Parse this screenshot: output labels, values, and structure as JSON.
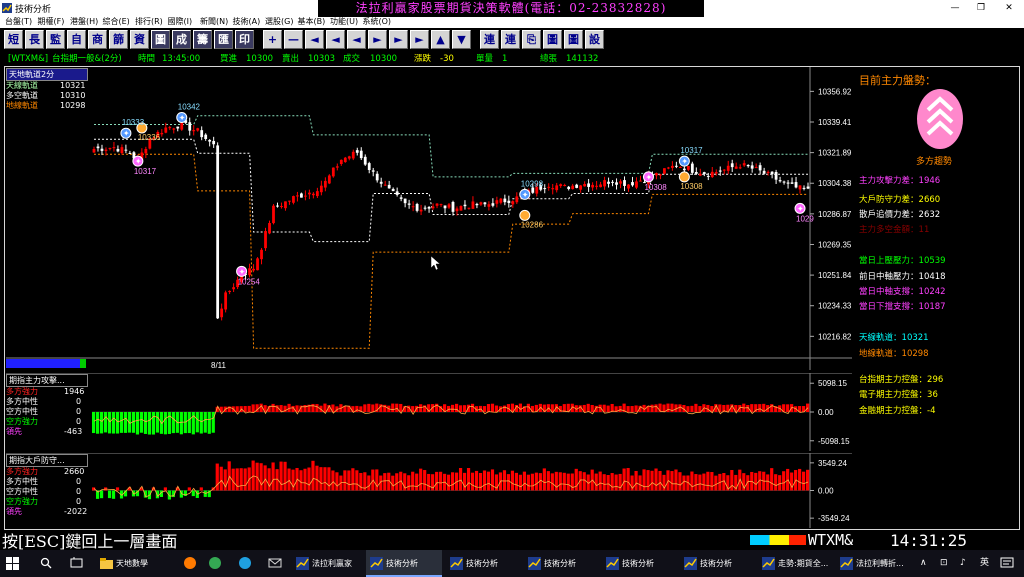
{
  "window": {
    "title": "技術分析",
    "min_glyph": "—",
    "max_glyph": "❐",
    "close_glyph": "✕"
  },
  "banner": "法拉利贏家股票期貨決策軟體(電話：02-23832828)",
  "menu": [
    "台盤(T)",
    "期權(F)",
    "港盤(H)",
    "綜合(E)",
    "排行(R)",
    "國際(I)",
    "新聞(N)",
    "技術(A)",
    "選股(G)",
    "基本(B)",
    "功能(U)",
    "系統(O)"
  ],
  "toolbar": [
    "短",
    "長",
    "監",
    "自",
    "商",
    "篩",
    "資",
    "圖",
    "成",
    "籌",
    "匯",
    "印",
    "+",
    "—",
    "◄",
    "◄",
    "◄",
    "►",
    "►",
    "►",
    "▲",
    "▼",
    "連",
    "連",
    "⎘",
    "圖",
    "圖",
    "設"
  ],
  "status": {
    "code": "[WTXM&]",
    "name": "台指期一般&(2分)",
    "time_label": "時間",
    "time": "13:45:00",
    "bid_label": "買進",
    "bid": "10300",
    "ask_label": "賣出",
    "ask": "10303",
    "deal_label": "成交",
    "deal": "10300",
    "chg_label": "漲跌",
    "chg": "-30",
    "vol_label": "單量",
    "vol": "1",
    "total_label": "總張",
    "total": "141132"
  },
  "main_legend": {
    "title": "天地軌道2分",
    "rows": [
      {
        "label": "天線軌道",
        "value": "10321"
      },
      {
        "label": "多空軌道",
        "value": "10310"
      },
      {
        "label": "地線軌道",
        "value": "10298"
      }
    ]
  },
  "sub1_legend": {
    "title": "期指主力攻擊...",
    "rows": [
      {
        "label": "多方強力",
        "value": "1946"
      },
      {
        "label": "多方中性",
        "value": "0"
      },
      {
        "label": "空方中性",
        "value": "0"
      },
      {
        "label": "空方強力",
        "value": "0"
      },
      {
        "label": "領先",
        "value": "-463"
      }
    ]
  },
  "sub2_legend": {
    "title": "期指大戶防守...",
    "rows": [
      {
        "label": "多方強力",
        "value": "2660"
      },
      {
        "label": "多方中性",
        "value": "0"
      },
      {
        "label": "空方中性",
        "value": "0"
      },
      {
        "label": "空方強力",
        "value": "0"
      },
      {
        "label": "領先",
        "value": "-2022"
      }
    ]
  },
  "colors": {
    "up": "#ff0000",
    "down": "#ffffff",
    "sky": "#88ddbb",
    "ground": "#ff8800",
    "mid": "#ffffff",
    "bull_fill": "#ff0000",
    "bear_fill": "#00ff00"
  },
  "chart_data": [
    {
      "type": "candlestick",
      "y_ticks": [
        "10356.92",
        "10339.41",
        "10321.89",
        "10304.38",
        "10286.87",
        "10269.35",
        "10251.84",
        "10234.33",
        "10216.82"
      ],
      "ylim": [
        10205,
        10368
      ],
      "x_tick": "8/11",
      "markers": [
        {
          "label": "10342",
          "kind": "sky",
          "price": 10342,
          "idx": 22
        },
        {
          "label": "10336",
          "kind": "ground",
          "price": 10336,
          "idx": 12
        },
        {
          "label": "10333",
          "kind": "sky",
          "price": 10333,
          "idx": 8
        },
        {
          "label": "10317",
          "kind": "low",
          "price": 10317,
          "idx": 11
        },
        {
          "label": "10254",
          "kind": "low",
          "price": 10254,
          "idx": 37
        },
        {
          "label": "10298",
          "kind": "sky",
          "price": 10298,
          "idx": 108
        },
        {
          "label": "10286",
          "kind": "ground",
          "price": 10286,
          "idx": 108
        },
        {
          "label": "10317",
          "kind": "sky",
          "price": 10317,
          "idx": 148
        },
        {
          "label": "10308",
          "kind": "ground",
          "price": 10308,
          "idx": 148
        },
        {
          "label": "10308",
          "kind": "low",
          "price": 10308,
          "idx": 139
        },
        {
          "label": "1029",
          "kind": "low",
          "price": 10290,
          "idx": 177
        }
      ]
    },
    {
      "type": "bar",
      "y_ticks": [
        "5098.15",
        "0.00",
        "-5098.15"
      ],
      "ylim": [
        -6200,
        6200
      ]
    },
    {
      "type": "bar",
      "y_ticks": [
        "3549.24",
        "0.00",
        "-3549.24"
      ],
      "ylim": [
        -4300,
        4300
      ]
    }
  ],
  "right_panel": {
    "title": "目前主力盤勢：",
    "trend": "多方趨勢",
    "items": [
      {
        "label": "主力攻擊力差",
        "value": "1946",
        "color": "#ff40ff"
      },
      {
        "label": "大戶防守力差",
        "value": "2660",
        "color": "#ffff00"
      },
      {
        "label": "散戶追價力差",
        "value": "2632",
        "color": "#ffffff"
      },
      {
        "label": "主力多空金額",
        "value": "11",
        "color": "#880000"
      },
      {
        "label": "當日上壓壓力",
        "value": "10539",
        "color": "#00ff00"
      },
      {
        "label": "前日中軸壓力",
        "value": "10418",
        "color": "#ffffff"
      },
      {
        "label": "當日中軸支撐",
        "value": "10242",
        "color": "#ff40ff"
      },
      {
        "label": "當日下擋支撐",
        "value": "10187",
        "color": "#ff40ff"
      },
      {
        "label": "天線軌道",
        "value": "10321",
        "color": "#00ffff"
      },
      {
        "label": "地線軌道",
        "value": "10298",
        "color": "#ff8800"
      },
      {
        "label": "台指期主力控盤",
        "value": "296",
        "color": "#ffff00"
      },
      {
        "label": "電子期主力控盤",
        "value": "36",
        "color": "#ffff00"
      },
      {
        "label": "金融期主力控盤",
        "value": "-4",
        "color": "#ffff00"
      }
    ]
  },
  "bottom": {
    "esc_msg": "按[ESC]鍵回上一層畫面",
    "code": "WTXM&",
    "clock": "14:31:25"
  },
  "taskbar": {
    "items": [
      "天地數學",
      "法拉利贏家",
      "技術分析",
      "技術分析",
      "技術分析",
      "技術分析",
      "技術分析",
      "走勢:期貨全...",
      "法拉利轉折..."
    ],
    "ime": "英",
    "ime_icons": [
      "∧",
      "⊡",
      "♪"
    ]
  }
}
